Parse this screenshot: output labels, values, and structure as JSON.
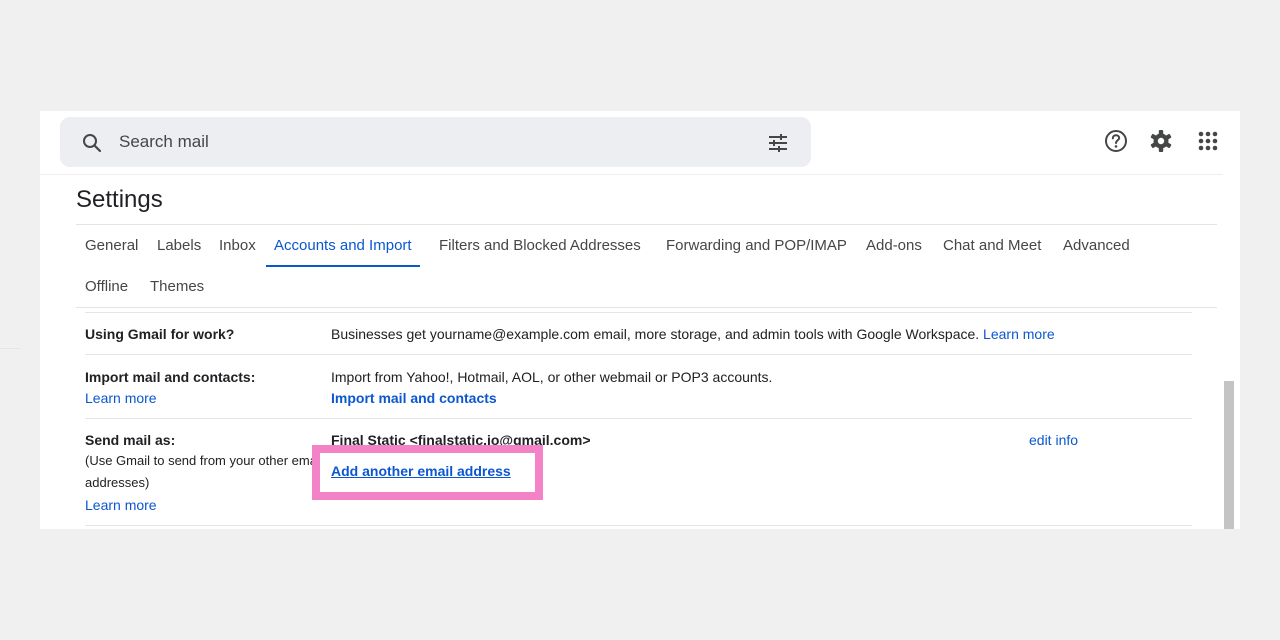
{
  "search": {
    "placeholder": "Search mail"
  },
  "header": {
    "icons": [
      "search-icon",
      "tune-icon",
      "help-icon",
      "gear-icon",
      "apps-icon"
    ]
  },
  "settings": {
    "title": "Settings"
  },
  "tabs": [
    {
      "label": "General",
      "active": false
    },
    {
      "label": "Labels",
      "active": false
    },
    {
      "label": "Inbox",
      "active": false
    },
    {
      "label": "Accounts and Import",
      "active": true
    },
    {
      "label": "Filters and Blocked Addresses",
      "active": false
    },
    {
      "label": "Forwarding and POP/IMAP",
      "active": false
    },
    {
      "label": "Add-ons",
      "active": false
    },
    {
      "label": "Chat and Meet",
      "active": false
    },
    {
      "label": "Advanced",
      "active": false
    },
    {
      "label": "Offline",
      "active": false
    },
    {
      "label": "Themes",
      "active": false
    }
  ],
  "rows": {
    "workspace": {
      "label": "Using Gmail for work?",
      "text": "Businesses get yourname@example.com email, more storage, and admin tools with Google Workspace.",
      "link": "Learn more"
    },
    "import": {
      "label": "Import mail and contacts:",
      "learn_more": "Learn more",
      "text": "Import from Yahoo!, Hotmail, AOL, or other webmail or POP3 accounts.",
      "action": "Import mail and contacts"
    },
    "send_as": {
      "label": "Send mail as:",
      "sub_line1": "(Use Gmail to send from your other email",
      "sub_line2": "addresses)",
      "learn_more": "Learn more",
      "sender": "Final Static <finalstatic.io@gmail.com>",
      "edit": "edit info",
      "add_address": "Add another email address"
    }
  },
  "colors": {
    "accent": "#0b57d0",
    "highlight": "#f382c7",
    "background": "#f1f0f1"
  }
}
